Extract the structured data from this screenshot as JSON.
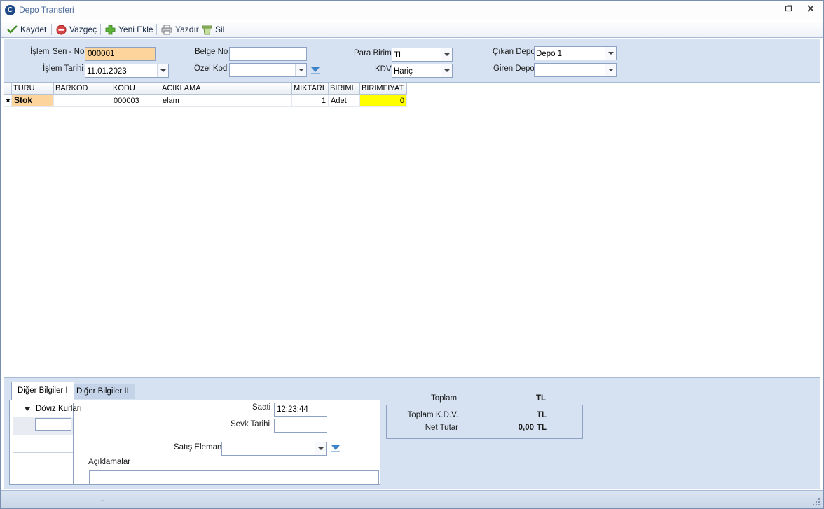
{
  "window": {
    "title": "Depo Transferi",
    "logo_letter": "C"
  },
  "toolbar": {
    "save": "Kaydet",
    "cancel": "Vazgeç",
    "add_new": "Yeni Ekle",
    "print": "Yazdır",
    "delete": "Sil"
  },
  "header": {
    "islem_label_a": "İşlem",
    "islem_label_b": "Seri - No",
    "islem_no": "000001",
    "islem_tarihi_label": "İşlem Tarihi",
    "islem_tarihi": "11.01.2023",
    "belge_no_label": "Belge No",
    "belge_no": "",
    "ozel_kod_label": "Özel Kod",
    "ozel_kod": "",
    "para_birimi_label": "Para Birimi",
    "para_birimi": "TL",
    "kdv_label": "KDV",
    "kdv": "Hariç",
    "cikan_depo_label": "Çıkan Depo",
    "cikan_depo": "Depo 1",
    "giren_depo_label": "Giren Depo",
    "giren_depo": ""
  },
  "grid": {
    "columns": [
      "TURU",
      "BARKOD",
      "KODU",
      "ACIKLAMA",
      "MIKTARI",
      "BIRIMI",
      "BIRIMFIYAT"
    ],
    "rows": [
      {
        "indicator": "★",
        "turu": "Stok",
        "barkod": "",
        "kodu": "000003",
        "aciklama": "elam",
        "miktari": "1",
        "birimi": "Adet",
        "birimfiyat": "0"
      }
    ]
  },
  "bottom": {
    "tab1": "Diğer Bilgiler I",
    "tab2": "Diğer Bilgiler II",
    "doviz_kurlari": "Döviz Kurları",
    "saati_label": "Saati",
    "saati": "12:23:44",
    "sevk_tarihi_label": "Sevk Tarihi",
    "sevk_tarihi": "",
    "satis_elemani_label": "Satış Elemanı",
    "satis_elemani": "",
    "aciklamalar_label": "Açıklamalar",
    "aciklamalar": ""
  },
  "totals": {
    "toplam_label": "Toplam",
    "toplam_currency": "TL",
    "toplam_kdv_label": "Toplam K.D.V.",
    "toplam_kdv_currency": "TL",
    "net_tutar_label": "Net Tutar",
    "net_tutar": "0,00",
    "net_tutar_currency": "TL"
  },
  "status": {
    "text": "..."
  },
  "colors": {
    "accent": "#4e6d9c",
    "panel": "#d6e2f1",
    "highlight_orange": "#fcd49c",
    "highlight_yellow": "#ffff00"
  }
}
